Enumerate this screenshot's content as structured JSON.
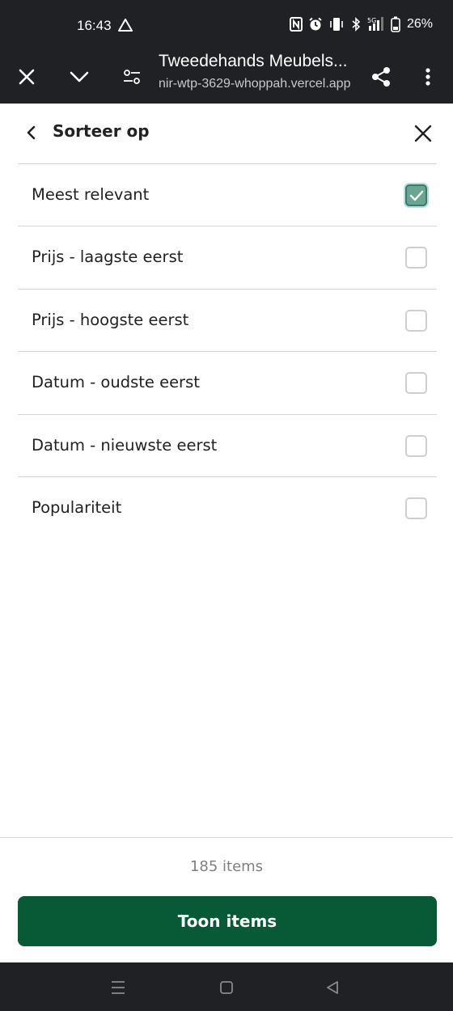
{
  "status_bar": {
    "time": "16:43",
    "battery": "26%",
    "network": "5G"
  },
  "browser": {
    "title": "Tweedehands Meubels...",
    "url": "nir-wtp-3629-whoppah.vercel.app"
  },
  "sheet": {
    "title": "Sorteer op"
  },
  "options": [
    {
      "label": "Meest relevant",
      "checked": true
    },
    {
      "label": "Prijs - laagste eerst",
      "checked": false
    },
    {
      "label": "Prijs - hoogste eerst",
      "checked": false
    },
    {
      "label": "Datum - oudste eerst",
      "checked": false
    },
    {
      "label": "Datum - nieuwste eerst",
      "checked": false
    },
    {
      "label": "Populariteit",
      "checked": false
    }
  ],
  "footer": {
    "items_count": "185 items",
    "button_label": "Toon items"
  },
  "colors": {
    "primary_button": "#075a35",
    "checkbox_checked": "#6aa592",
    "system_bar": "#202124"
  },
  "icons": [
    "warning-icon",
    "nfc-icon",
    "alarm-icon",
    "vibrate-icon",
    "bluetooth-icon",
    "signal-icon",
    "battery-icon",
    "close-icon",
    "chevron-down-icon",
    "tune-icon",
    "share-icon",
    "more-vert-icon",
    "back-arrow-icon",
    "check-icon",
    "recents-icon",
    "home-icon",
    "back-nav-icon"
  ]
}
